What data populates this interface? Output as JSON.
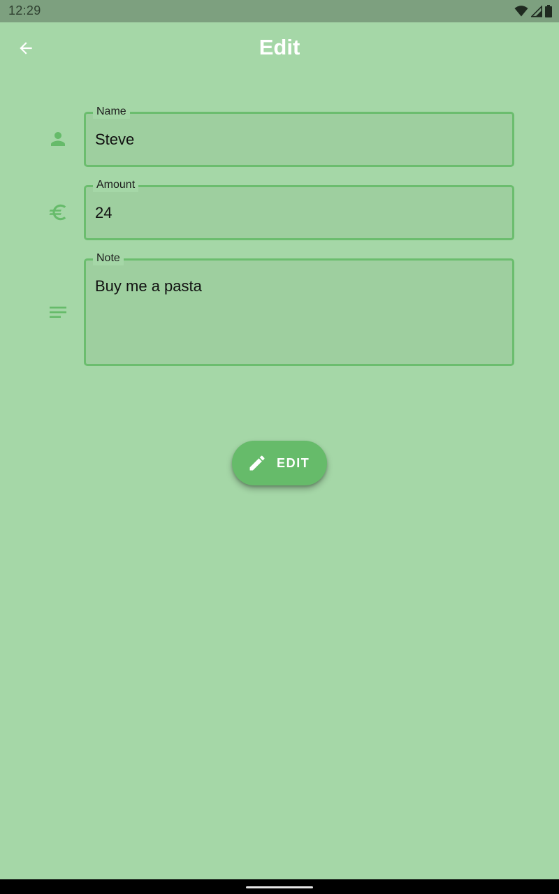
{
  "status_bar": {
    "time": "12:29",
    "icons": [
      "wifi-icon",
      "signal-icon",
      "battery-icon"
    ]
  },
  "app_bar": {
    "title": "Edit",
    "back_icon": "arrow-back-icon"
  },
  "form": {
    "name": {
      "label": "Name",
      "value": "Steve",
      "icon": "person-icon"
    },
    "amount": {
      "label": "Amount",
      "value": "24",
      "icon": "euro-icon"
    },
    "note": {
      "label": "Note",
      "value": "Buy me a pasta",
      "icon": "notes-icon"
    }
  },
  "fab": {
    "label": "EDIT",
    "icon": "pencil-icon"
  },
  "colors": {
    "background": "#a5d7a7",
    "accent": "#66bb6a",
    "field_fill": "#9ecf9f",
    "status_bar": "#7da07f"
  }
}
